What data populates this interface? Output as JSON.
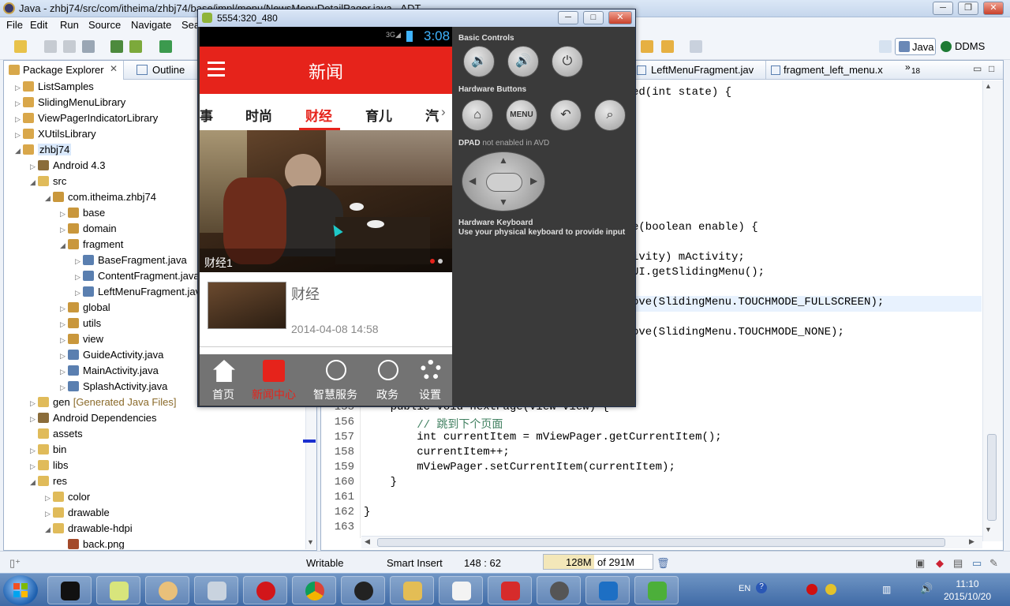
{
  "window": {
    "title": "Java - zhbj74/src/com/itheima/zhbj74/base/impl/menu/NewsMenuDetailPager.java - ADT"
  },
  "menu": [
    "File",
    "Edit",
    "Run",
    "Source",
    "Navigate",
    "Sea"
  ],
  "package_explorer": {
    "tab_label": "Package Explorer",
    "outline_label": "Outline",
    "items": [
      {
        "label": "ListSamples",
        "type": "project"
      },
      {
        "label": "SlidingMenuLibrary",
        "type": "project"
      },
      {
        "label": "ViewPagerIndicatorLibrary",
        "type": "project"
      },
      {
        "label": "XUtilsLibrary",
        "type": "project"
      },
      {
        "label": "zhbj74",
        "type": "project"
      },
      {
        "label": "Android 4.3",
        "type": "lib"
      },
      {
        "label": "src",
        "type": "folder"
      },
      {
        "label": "com.itheima.zhbj74",
        "type": "package"
      },
      {
        "label": "base",
        "type": "package"
      },
      {
        "label": "domain",
        "type": "package"
      },
      {
        "label": "fragment",
        "type": "package"
      },
      {
        "label": "BaseFragment.java",
        "type": "java"
      },
      {
        "label": "ContentFragment.java",
        "type": "java"
      },
      {
        "label": "LeftMenuFragment.java",
        "type": "java"
      },
      {
        "label": "global",
        "type": "package"
      },
      {
        "label": "utils",
        "type": "package"
      },
      {
        "label": "view",
        "type": "package"
      },
      {
        "label": "GuideActivity.java",
        "type": "java"
      },
      {
        "label": "MainActivity.java",
        "type": "java"
      },
      {
        "label": "SplashActivity.java",
        "type": "java"
      },
      {
        "label": "gen",
        "type": "folder",
        "suffix": "[Generated Java Files]"
      },
      {
        "label": "Android Dependencies",
        "type": "lib"
      },
      {
        "label": "assets",
        "type": "folder"
      },
      {
        "label": "bin",
        "type": "folder"
      },
      {
        "label": "libs",
        "type": "folder"
      },
      {
        "label": "res",
        "type": "folder"
      },
      {
        "label": "color",
        "type": "folder"
      },
      {
        "label": "drawable",
        "type": "folder"
      },
      {
        "label": "drawable-hdpi",
        "type": "folder"
      },
      {
        "label": "back.png",
        "type": "file"
      }
    ]
  },
  "editor": {
    "tabs": [
      "LeftMenuFragment.jav",
      "fragment_left_menu.x",
      "18"
    ],
    "upper_lines": [
      "ed(int state) {",
      "e(boolean enable) {",
      "ivity) mActivity;",
      "UI.getSlidingMenu();",
      "ove(SlidingMenu.TOUCHMODE_FULLSCREEN);",
      "ove(SlidingMenu.TOUCHMODE_NONE);"
    ],
    "lines": [
      {
        "n": "155",
        "code": "    public void nextPage(View view) {"
      },
      {
        "n": "156",
        "code": "        // 跳到下个页面"
      },
      {
        "n": "157",
        "code": "        int currentItem = mViewPager.getCurrentItem();"
      },
      {
        "n": "158",
        "code": "        currentItem++;"
      },
      {
        "n": "159",
        "code": "        mViewPager.setCurrentItem(currentItem);"
      },
      {
        "n": "160",
        "code": "    }"
      },
      {
        "n": "161",
        "code": ""
      },
      {
        "n": "162",
        "code": "}"
      },
      {
        "n": "163",
        "code": ""
      }
    ]
  },
  "perspectives": {
    "java": "Java",
    "ddms": "DDMS"
  },
  "status": {
    "writable": "Writable",
    "insert": "Smart Insert",
    "position": "148 : 62",
    "heap_used": "128M",
    "heap_total": "of 291M"
  },
  "emulator": {
    "title": "5554:320_480",
    "clock": "3:08",
    "app_title": "新闻",
    "tabs": [
      "事",
      "时尚",
      "财经",
      "育儿",
      "汽"
    ],
    "active_tab": "财经",
    "banner_caption": "财经1",
    "news_item": {
      "title": "财经",
      "date": "2014-04-08 14:58"
    },
    "bottom_nav": [
      "首页",
      "新闻中心",
      "智慧服务",
      "政务",
      "设置"
    ],
    "active_nav": "新闻中心",
    "controls": {
      "basic_label": "Basic Controls",
      "hw_label": "Hardware Buttons",
      "menu_label": "MENU",
      "dpad_label": "DPAD",
      "dpad_note": "not enabled in AVD",
      "kb_label": "Hardware Keyboard",
      "kb_note": "Use your physical keyboard to provide input"
    }
  },
  "taskbar": {
    "lang": "EN",
    "time": "11:10",
    "date": "2015/10/20"
  },
  "colors": {
    "accent": "#e6231b",
    "keyword": "#7f0055",
    "field": "#0000c0",
    "comment": "#3f7f5f"
  }
}
